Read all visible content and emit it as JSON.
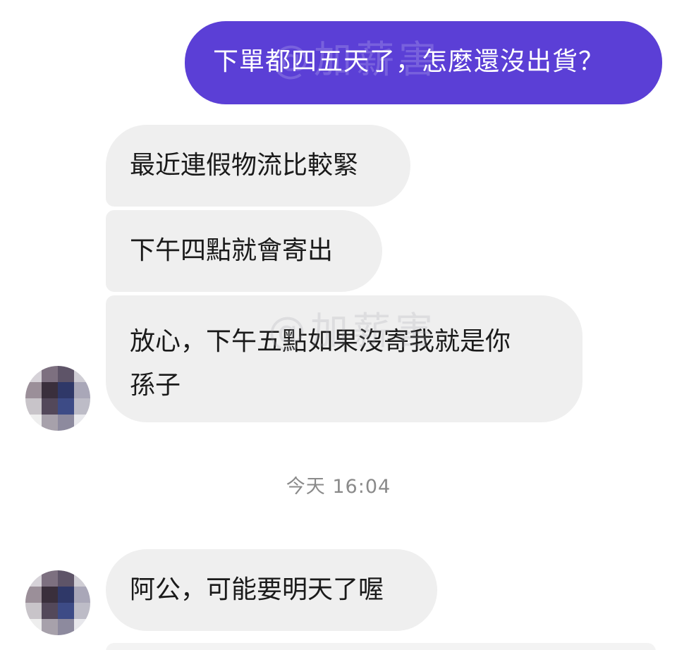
{
  "messages": {
    "outgoing_1": "下單都四五天了，怎麼還沒出貨？",
    "incoming_1": "最近連假物流比較緊",
    "incoming_2": "下午四點就會寄出",
    "incoming_3_line1": "放心，下午五點如果沒寄我就是你",
    "incoming_3_line2": "孫子",
    "incoming_4": "阿公，可能要明天了喔"
  },
  "timestamp": "今天 16:04",
  "watermark": "@加薪害",
  "colors": {
    "outgoing_bubble": "#5b3fd6",
    "incoming_bubble": "#efefef",
    "timestamp_text": "#8a8a8a"
  },
  "avatar_icon": "pixelated-avatar-icon"
}
